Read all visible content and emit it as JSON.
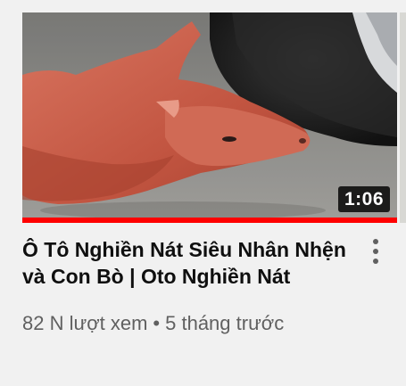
{
  "video": {
    "duration": "1:06",
    "progress_fraction": 1.0,
    "title": "Ô Tô Nghiền Nát Siêu Nhân Nhện và Con Bò | Oto Nghiền Nát",
    "views": "82 N lượt xem",
    "separator": "•",
    "age": "5 tháng trước"
  },
  "icons": {
    "menu": "more-vert-icon"
  },
  "colors": {
    "progress": "#ff0000",
    "title": "#0f0f0f",
    "meta": "#606060",
    "background": "#f1f1f1"
  }
}
